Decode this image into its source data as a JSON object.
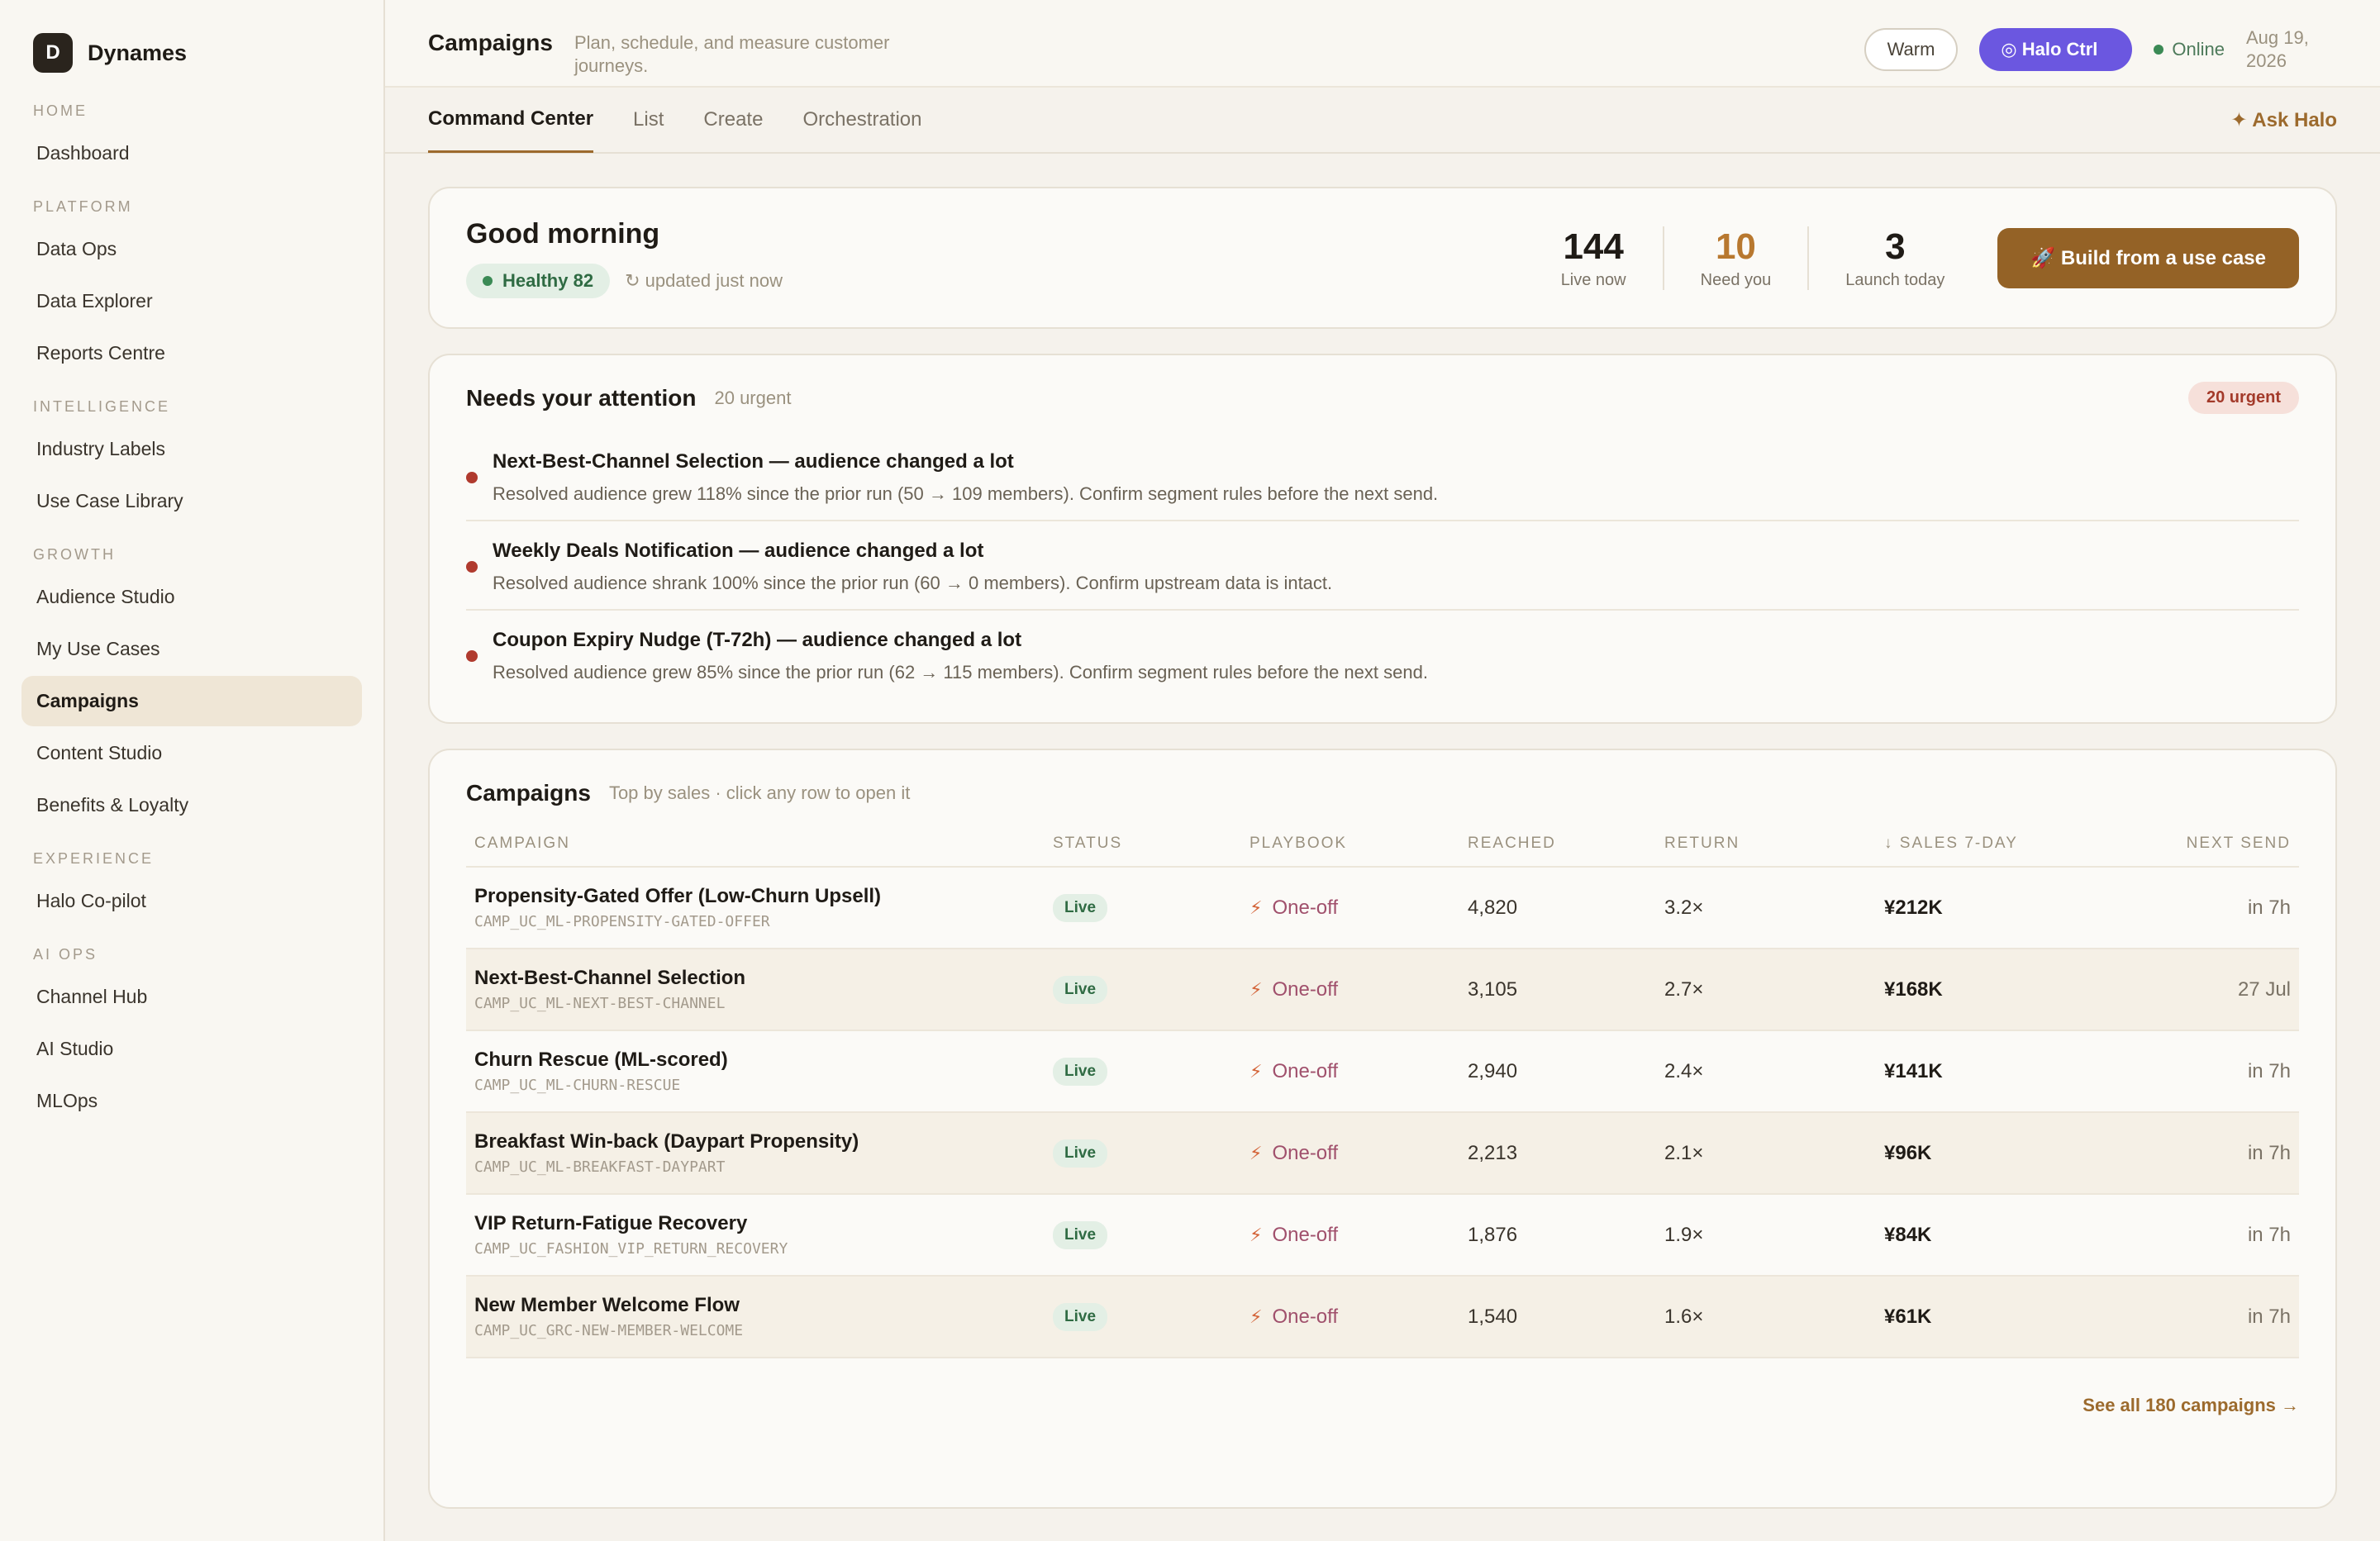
{
  "brand": {
    "logo": "D",
    "name": "Dynames"
  },
  "sidebar": {
    "sections": [
      {
        "label": "HOME",
        "items": [
          "Dashboard"
        ]
      },
      {
        "label": "PLATFORM",
        "items": [
          "Data Ops",
          "Data Explorer",
          "Reports Centre"
        ]
      },
      {
        "label": "INTELLIGENCE",
        "items": [
          "Industry Labels",
          "Use Case Library"
        ]
      },
      {
        "label": "GROWTH",
        "items": [
          "Audience Studio",
          "My Use Cases",
          "Campaigns",
          "Content Studio",
          "Benefits & Loyalty"
        ]
      },
      {
        "label": "EXPERIENCE",
        "items": [
          "Halo Co-pilot"
        ]
      },
      {
        "label": "AI OPS",
        "items": [
          "Channel Hub",
          "AI Studio",
          "MLOps"
        ]
      }
    ],
    "active_item": "Campaigns"
  },
  "header": {
    "title": "Campaigns",
    "subtitle": "Plan, schedule, and measure customer journeys.",
    "warm_label": "Warm",
    "halo_label": "◎ Halo  Ctrl",
    "status": "Online",
    "date": "Aug 19, 2026"
  },
  "tabs": [
    {
      "label": "Command Center",
      "active": true
    },
    {
      "label": "List",
      "active": false
    },
    {
      "label": "Create",
      "active": false
    },
    {
      "label": "Orchestration",
      "active": false
    }
  ],
  "ask_halo": "✦ Ask Halo",
  "greeting": {
    "title": "Good morning",
    "health": "Healthy 82",
    "updated": "↻ updated just now",
    "stats": [
      {
        "value": "144",
        "label": "Live now"
      },
      {
        "value": "10",
        "label": "Need you"
      },
      {
        "value": "3",
        "label": "Launch today"
      }
    ],
    "build_button": "🚀 Build from a use case"
  },
  "attention": {
    "title": "Needs your attention",
    "subtitle": "20 urgent",
    "badge": "20 urgent",
    "items": [
      {
        "title": "Next-Best-Channel Selection — audience changed a lot",
        "desc": "Resolved audience grew 118% since the prior run (50 → 109 members). Confirm segment rules before the next send."
      },
      {
        "title": "Weekly Deals Notification — audience changed a lot",
        "desc": "Resolved audience shrank 100% since the prior run (60 → 0 members). Confirm upstream data is intact."
      },
      {
        "title": "Coupon Expiry Nudge (T-72h) — audience changed a lot",
        "desc": "Resolved audience grew 85% since the prior run (62 → 115 members). Confirm segment rules before the next send."
      }
    ]
  },
  "campaigns": {
    "title": "Campaigns",
    "subtitle": "Top by sales · click any row to open it",
    "columns": [
      "CAMPAIGN",
      "STATUS",
      "PLAYBOOK",
      "REACHED",
      "RETURN",
      "↓ SALES 7-DAY",
      "NEXT SEND"
    ],
    "rows": [
      {
        "name": "Propensity-Gated Offer (Low-Churn Upsell)",
        "id": "CAMP_UC_ML-PROPENSITY-GATED-OFFER",
        "status": "Live",
        "playbook": "One-off",
        "reached": "4,820",
        "return": "3.2×",
        "sales": "¥212K",
        "next": "in 7h"
      },
      {
        "name": "Next-Best-Channel Selection",
        "id": "CAMP_UC_ML-NEXT-BEST-CHANNEL",
        "status": "Live",
        "playbook": "One-off",
        "reached": "3,105",
        "return": "2.7×",
        "sales": "¥168K",
        "next": "27 Jul"
      },
      {
        "name": "Churn Rescue (ML-scored)",
        "id": "CAMP_UC_ML-CHURN-RESCUE",
        "status": "Live",
        "playbook": "One-off",
        "reached": "2,940",
        "return": "2.4×",
        "sales": "¥141K",
        "next": "in 7h"
      },
      {
        "name": "Breakfast Win-back (Daypart Propensity)",
        "id": "CAMP_UC_ML-BREAKFAST-DAYPART",
        "status": "Live",
        "playbook": "One-off",
        "reached": "2,213",
        "return": "2.1×",
        "sales": "¥96K",
        "next": "in 7h"
      },
      {
        "name": "VIP Return-Fatigue Recovery",
        "id": "CAMP_UC_FASHION_VIP_RETURN_RECOVERY",
        "status": "Live",
        "playbook": "One-off",
        "reached": "1,876",
        "return": "1.9×",
        "sales": "¥84K",
        "next": "in 7h"
      },
      {
        "name": "New Member Welcome Flow",
        "id": "CAMP_UC_GRC-NEW-MEMBER-WELCOME",
        "status": "Live",
        "playbook": "One-off",
        "reached": "1,540",
        "return": "1.6×",
        "sales": "¥61K",
        "next": "in 7h"
      }
    ],
    "see_all": "See all 180 campaigns →"
  },
  "icons": {
    "playbook": "bolt-icon",
    "status_dot": "dot-icon"
  },
  "colors": {
    "accent": "#946226",
    "halo": "#6b57e0",
    "live": "#2f6b43",
    "urgent": "#b03a2e"
  }
}
